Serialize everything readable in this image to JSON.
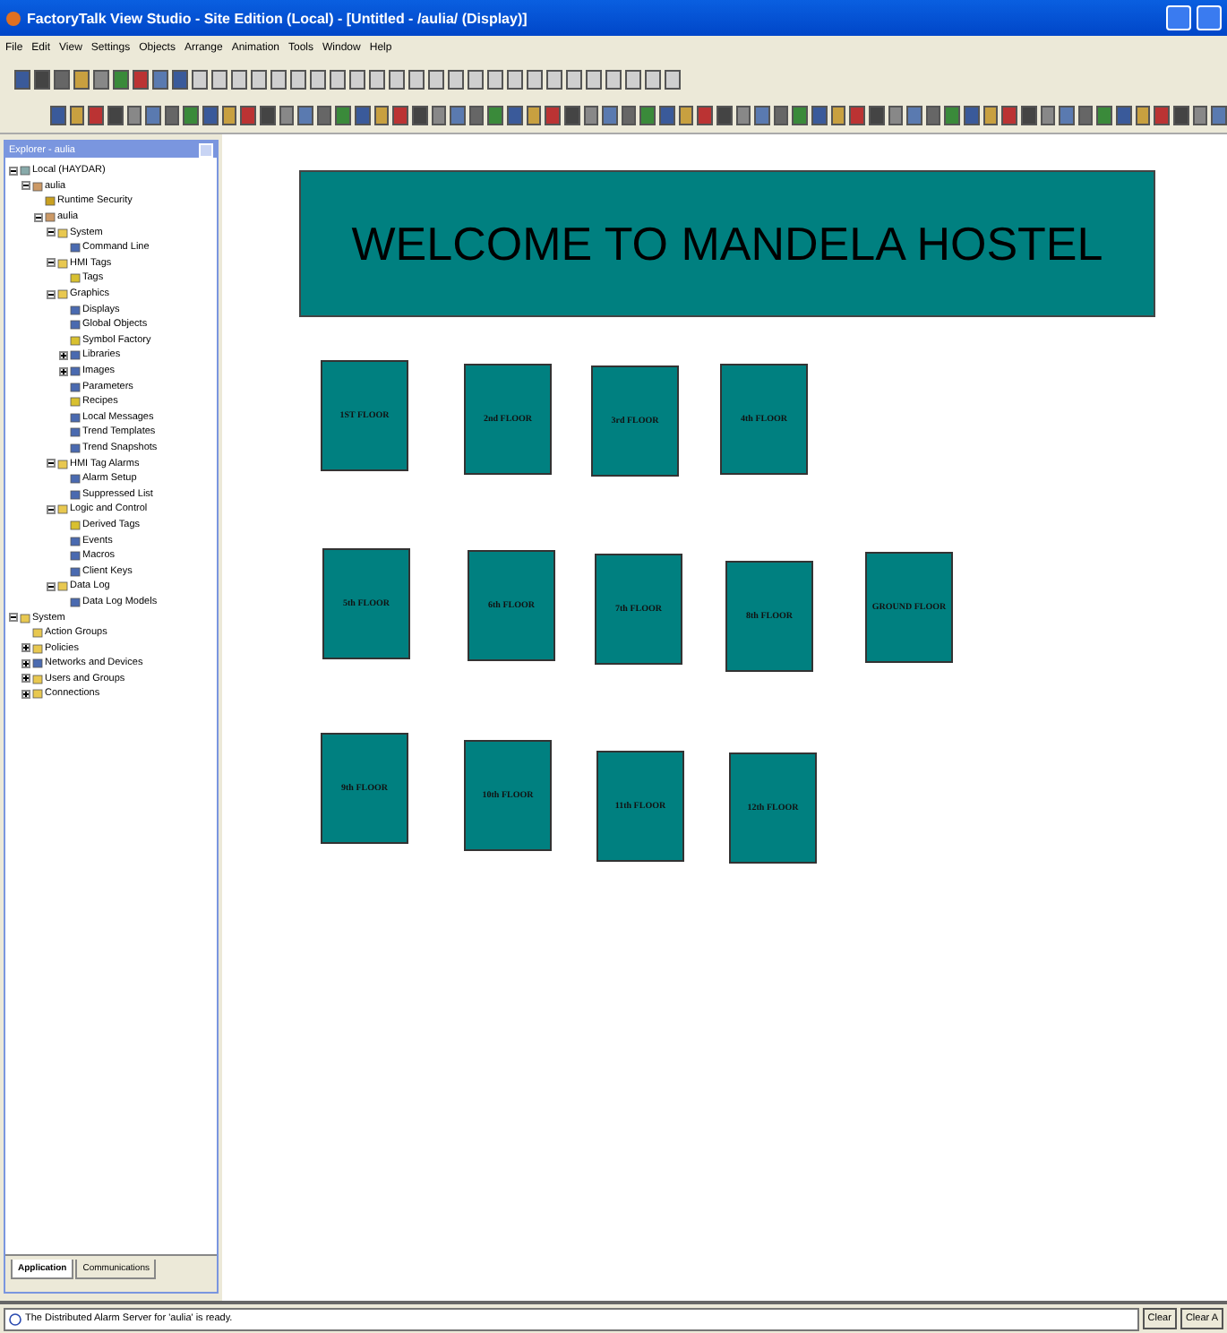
{
  "window": {
    "title": "FactoryTalk View Studio - Site Edition (Local) - [Untitled - /aulia/ (Display)]"
  },
  "menu": [
    "File",
    "Edit",
    "View",
    "Settings",
    "Objects",
    "Arrange",
    "Animation",
    "Tools",
    "Window",
    "Help"
  ],
  "explorer": {
    "title": "Explorer - aulia",
    "tree": [
      {
        "label": "Local (HAYDAR)",
        "kind": "computer",
        "expanded": true,
        "children": [
          {
            "label": "aulia",
            "kind": "app",
            "expanded": true,
            "children": [
              {
                "label": "Runtime Security",
                "kind": "key"
              },
              {
                "label": "aulia",
                "kind": "app",
                "expanded": true,
                "children": [
                  {
                    "label": "System",
                    "kind": "folder",
                    "expanded": true,
                    "children": [
                      {
                        "label": "Command Line",
                        "kind": "item"
                      }
                    ]
                  },
                  {
                    "label": "HMI Tags",
                    "kind": "folder",
                    "expanded": true,
                    "children": [
                      {
                        "label": "Tags",
                        "kind": "tag"
                      }
                    ]
                  },
                  {
                    "label": "Graphics",
                    "kind": "folder",
                    "expanded": true,
                    "children": [
                      {
                        "label": "Displays",
                        "kind": "item"
                      },
                      {
                        "label": "Global Objects",
                        "kind": "item"
                      },
                      {
                        "label": "Symbol Factory",
                        "kind": "tag"
                      },
                      {
                        "label": "Libraries",
                        "kind": "item",
                        "expanded": false
                      },
                      {
                        "label": "Images",
                        "kind": "item",
                        "expanded": false
                      },
                      {
                        "label": "Parameters",
                        "kind": "item"
                      },
                      {
                        "label": "Recipes",
                        "kind": "tag"
                      },
                      {
                        "label": "Local Messages",
                        "kind": "item"
                      },
                      {
                        "label": "Trend Templates",
                        "kind": "item"
                      },
                      {
                        "label": "Trend Snapshots",
                        "kind": "item"
                      }
                    ]
                  },
                  {
                    "label": "HMI Tag Alarms",
                    "kind": "folder",
                    "expanded": true,
                    "children": [
                      {
                        "label": "Alarm Setup",
                        "kind": "item"
                      },
                      {
                        "label": "Suppressed List",
                        "kind": "item"
                      }
                    ]
                  },
                  {
                    "label": "Logic and Control",
                    "kind": "folder",
                    "expanded": true,
                    "children": [
                      {
                        "label": "Derived Tags",
                        "kind": "tag"
                      },
                      {
                        "label": "Events",
                        "kind": "item"
                      },
                      {
                        "label": "Macros",
                        "kind": "item"
                      },
                      {
                        "label": "Client Keys",
                        "kind": "item"
                      }
                    ]
                  },
                  {
                    "label": "Data Log",
                    "kind": "folder",
                    "expanded": true,
                    "children": [
                      {
                        "label": "Data Log Models",
                        "kind": "item"
                      }
                    ]
                  }
                ]
              }
            ]
          }
        ]
      },
      {
        "label": "System",
        "kind": "folder",
        "expanded": true,
        "children": [
          {
            "label": "Action Groups",
            "kind": "folder"
          },
          {
            "label": "Policies",
            "kind": "folder",
            "expanded": false
          },
          {
            "label": "Networks and Devices",
            "kind": "network",
            "expanded": false
          },
          {
            "label": "Users and Groups",
            "kind": "folder",
            "expanded": false
          },
          {
            "label": "Connections",
            "kind": "folder",
            "expanded": false
          }
        ]
      }
    ],
    "tabs": [
      {
        "label": "Application",
        "selected": true
      },
      {
        "label": "Communications",
        "selected": false
      }
    ]
  },
  "display": {
    "banner": "WELCOME TO MANDELA HOSTEL",
    "floors": [
      "1ST FLOOR",
      "2nd FLOOR",
      "3rd FLOOR",
      "4th FLOOR",
      "5th FLOOR",
      "6th FLOOR",
      "7th FLOOR",
      "8th FLOOR",
      "GROUND FLOOR",
      "9th FLOOR",
      "10th FLOOR",
      "11th FLOOR",
      "12th FLOOR"
    ]
  },
  "status_bar": {
    "message": "The Distributed Alarm Server for 'aulia' is ready.",
    "buttons": [
      "Clear",
      "Clear A"
    ]
  }
}
